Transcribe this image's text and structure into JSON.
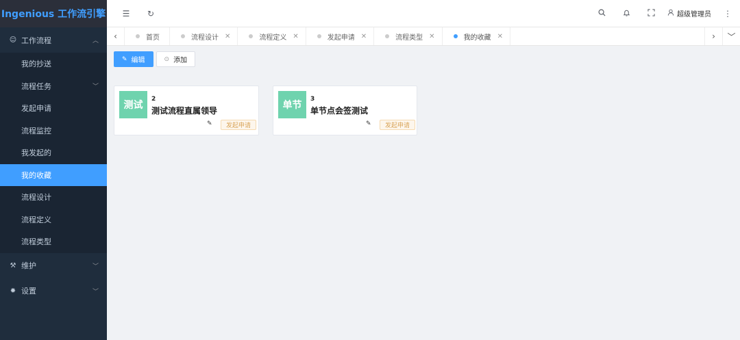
{
  "app": {
    "title": "Ingenious 工作流引擎"
  },
  "sidebar": {
    "groups": [
      {
        "label": "工作流程",
        "icon": "smile-icon",
        "expanded": true
      },
      {
        "label": "维护",
        "icon": "tools-icon",
        "expanded": false
      },
      {
        "label": "设置",
        "icon": "gear-icon",
        "expanded": false
      }
    ],
    "items": [
      {
        "label": "我的抄送"
      },
      {
        "label": "流程任务",
        "has_children": true
      },
      {
        "label": "发起申请"
      },
      {
        "label": "流程监控"
      },
      {
        "label": "我发起的"
      },
      {
        "label": "我的收藏",
        "active": true
      },
      {
        "label": "流程设计"
      },
      {
        "label": "流程定义"
      },
      {
        "label": "流程类型"
      }
    ]
  },
  "header": {
    "icons": [
      "menu-fold-icon",
      "refresh-icon",
      "search-icon",
      "bell-icon",
      "fullscreen-icon",
      "more-icon"
    ],
    "user": "超级管理员"
  },
  "tabs": [
    {
      "label": "首页",
      "closable": false
    },
    {
      "label": "流程设计",
      "closable": true
    },
    {
      "label": "流程定义",
      "closable": true
    },
    {
      "label": "发起申请",
      "closable": true
    },
    {
      "label": "流程类型",
      "closable": true
    },
    {
      "label": "我的收藏",
      "closable": true,
      "active": true
    }
  ],
  "toolbar": {
    "edit_label": "编辑",
    "add_label": "添加"
  },
  "cards": [
    {
      "badge": "测试",
      "number": "2",
      "title": "测试流程直属领导",
      "tag": "发起申请"
    },
    {
      "badge": "单节",
      "number": "3",
      "title": "单节点会签测试",
      "tag": "发起申请"
    }
  ],
  "colors": {
    "accent": "#409eff",
    "sidebar_bg": "#1f2d3d",
    "badge_bg": "#6fd3ae",
    "tag_text": "#d9a55a"
  }
}
